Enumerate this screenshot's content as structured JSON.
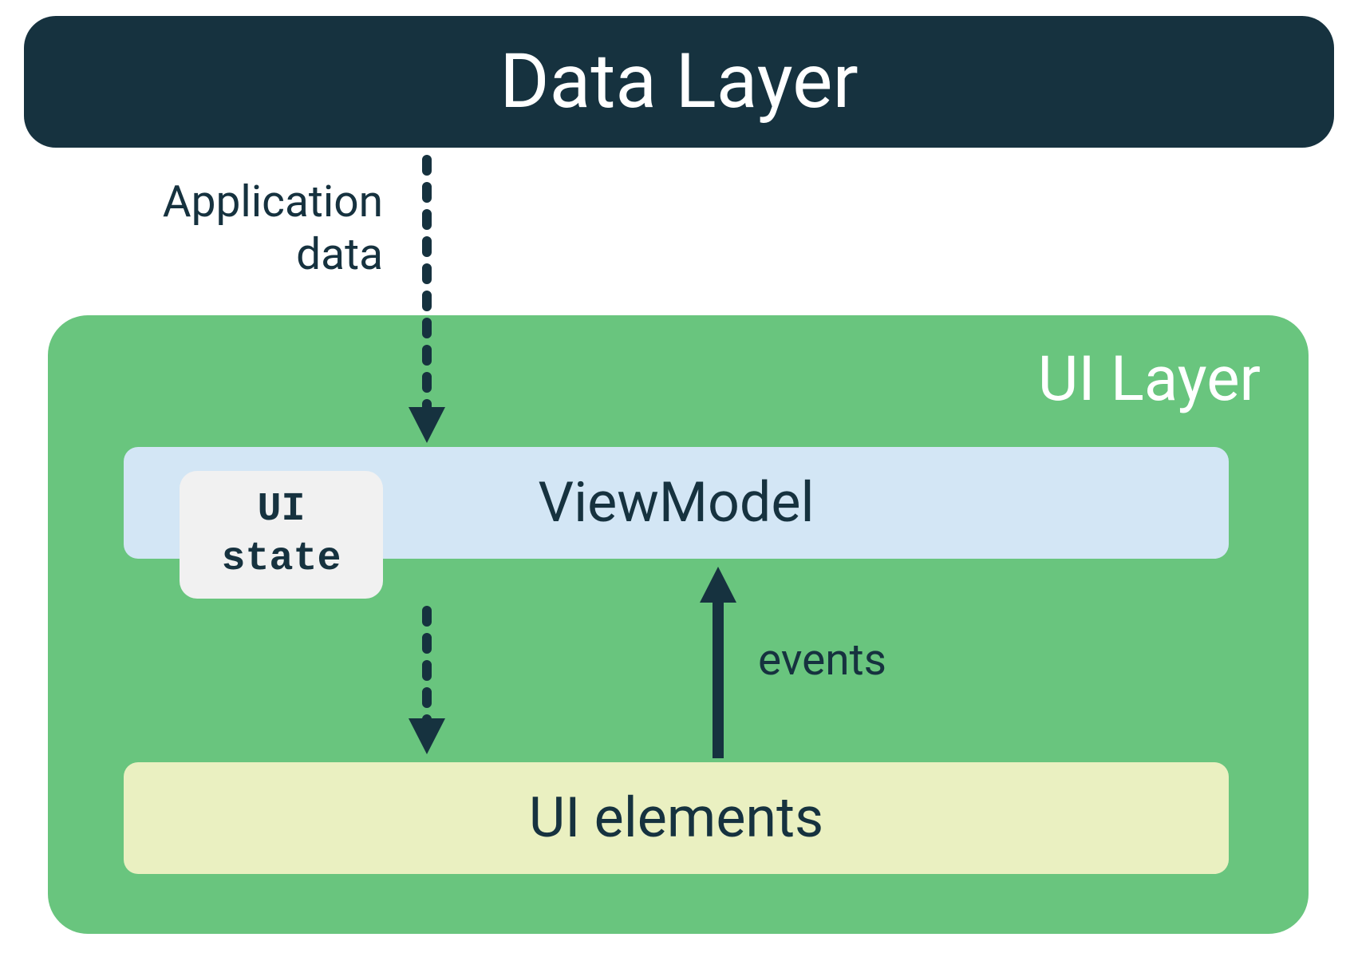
{
  "layers": {
    "data_layer": "Data Layer",
    "ui_layer": "UI Layer"
  },
  "components": {
    "viewmodel": "ViewModel",
    "ui_elements": "UI elements",
    "ui_state": "UI\nstate"
  },
  "labels": {
    "application_data": "Application\ndata",
    "events": "events"
  },
  "colors": {
    "dark_blue": "#16323f",
    "green": "#69c57e",
    "light_blue": "#d3e6f5",
    "light_yellow": "#eaf0c1",
    "light_gray": "#f1f1f1"
  }
}
